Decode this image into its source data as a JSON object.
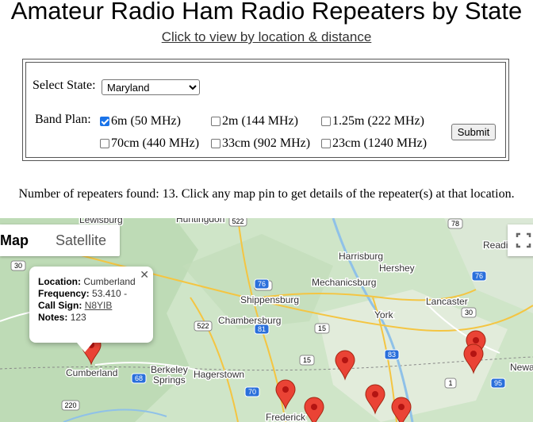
{
  "page": {
    "title": "Amateur Radio Ham Radio Repeaters by State",
    "location_link": "Click to view by location & distance"
  },
  "form": {
    "state_label": "Select State:",
    "state_value": "Maryland",
    "band_label": "Band Plan:",
    "bands": [
      {
        "label": "6m (50 MHz)",
        "checked": true
      },
      {
        "label": "2m (144 MHz)",
        "checked": false
      },
      {
        "label": "1.25m (222 MHz)",
        "checked": false
      },
      {
        "label": "70cm (440 MHz)",
        "checked": false
      },
      {
        "label": "33cm (902 MHz)",
        "checked": false
      },
      {
        "label": "23cm (1240 MHz)",
        "checked": false
      }
    ],
    "submit_label": "Submit"
  },
  "results": {
    "count_text": "Number of repeaters found: 13. Click any map pin to get details of the repeater(s) at that location."
  },
  "map": {
    "map_type_active": "Map",
    "map_type_inactive": "Satellite",
    "places": [
      "Harrisburg",
      "Hershey",
      "Mechanicsburg",
      "Lancaster",
      "Reading",
      "Shippensburg",
      "Chambersburg",
      "York",
      "Hagerstown",
      "Cumberland",
      "Berkeley",
      "Springs",
      "Frederick",
      "Huntingdon",
      "Lewisburg",
      "Newa"
    ],
    "route_shields": [
      "522",
      "78",
      "30",
      "322",
      "76",
      "81",
      "522",
      "15",
      "30",
      "83",
      "95",
      "68",
      "220",
      "70",
      "1",
      "76",
      "15"
    ],
    "pin_color": "#ea4335",
    "info_window": {
      "location_label": "Location:",
      "location_value": "Cumberland",
      "frequency_label": "Frequency:",
      "frequency_value": "53.410 -",
      "callsign_label": "Call Sign:",
      "callsign_value": "N8YIB",
      "notes_label": "Notes:",
      "notes_value": "123"
    }
  }
}
